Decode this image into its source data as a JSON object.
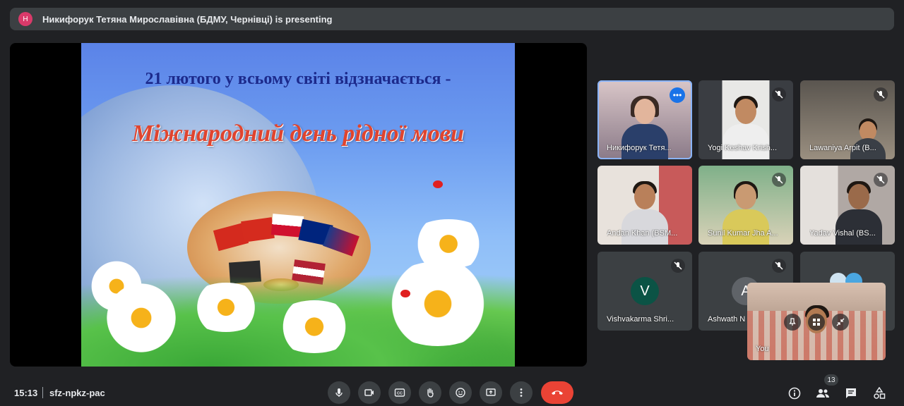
{
  "presenting": {
    "avatar_letter": "Н",
    "text": "Никифорук Тетяна Мирославівна (БДМУ, Чернівці) is presenting"
  },
  "slide": {
    "line1": "21 лютого у всьому світі відзначається -",
    "line2": "Міжнародний день рідної мови"
  },
  "participants": [
    {
      "name": "Никифорук Тетя...",
      "active": true
    },
    {
      "name": "Yogi Keshav Krish..."
    },
    {
      "name": "Lawaniya Arpit (B..."
    },
    {
      "name": "Andan Khan (BSM..."
    },
    {
      "name": "Sunil Kumar Jha A..."
    },
    {
      "name": "Yadav Vishal (BS..."
    },
    {
      "name": "Vishvakarma Shri...",
      "avatar_letter": "V",
      "avatar_color": "#0b5345"
    },
    {
      "name": "Ashwath N",
      "avatar_letter": "A",
      "avatar_color": "#5f6368"
    }
  ],
  "self_view": {
    "name": "You"
  },
  "bottom_bar": {
    "time": "15:13",
    "meeting_code": "sfz-npkz-pac",
    "participant_count": "13"
  },
  "colors": {
    "accent": "#8ab4f8",
    "end_call": "#ea4335",
    "active_blue": "#1a73e8"
  }
}
